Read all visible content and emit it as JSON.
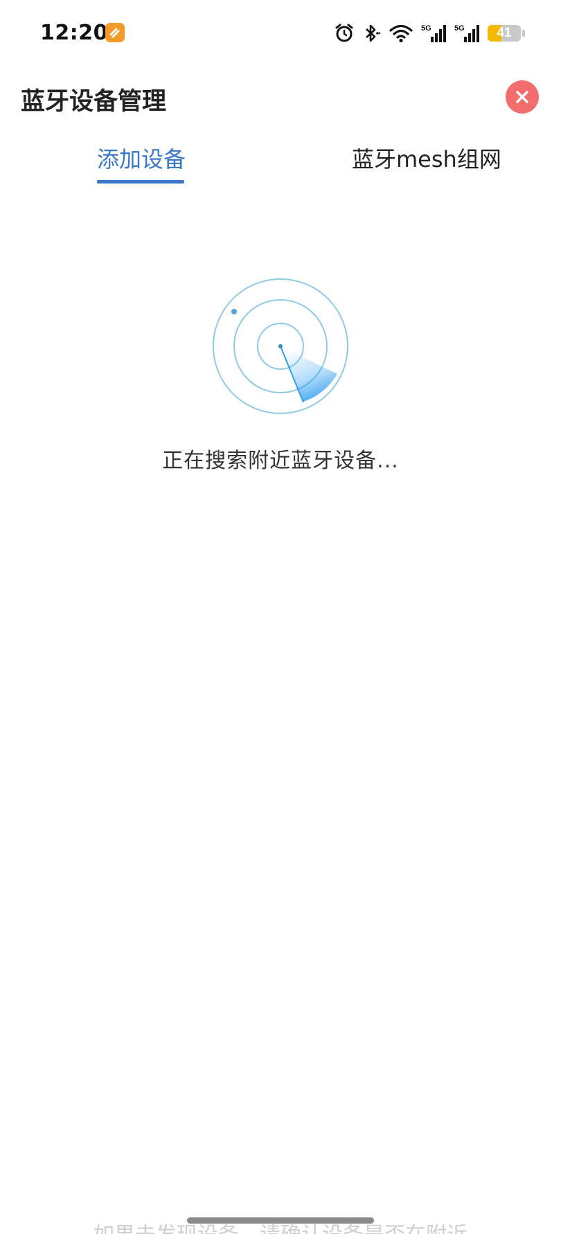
{
  "status_bar": {
    "time": "12:20",
    "network_1": "5G",
    "network_2": "5G",
    "battery_level": "41",
    "battery_fraction": 0.41
  },
  "header": {
    "title": "蓝牙设备管理"
  },
  "tabs": [
    {
      "label": "添加设备",
      "active": true
    },
    {
      "label": "蓝牙mesh组网",
      "active": false
    }
  ],
  "scan": {
    "status_text": "正在搜索附近蓝牙设备..."
  },
  "bottom": {
    "hint_text": "如果未发现设备，请确认设备是否在附近"
  },
  "colors": {
    "accent": "#3a78c9",
    "close": "#f26d6d",
    "radar_ring": "#8fcbe6",
    "radar_sweep": "#2f9ef0"
  },
  "icons": {
    "status_app": "app-badge-icon",
    "alarm": "alarm-icon",
    "bluetooth": "bluetooth-icon",
    "wifi": "wifi-icon",
    "signal": "signal-icon",
    "battery": "battery-icon",
    "close": "close-icon"
  }
}
